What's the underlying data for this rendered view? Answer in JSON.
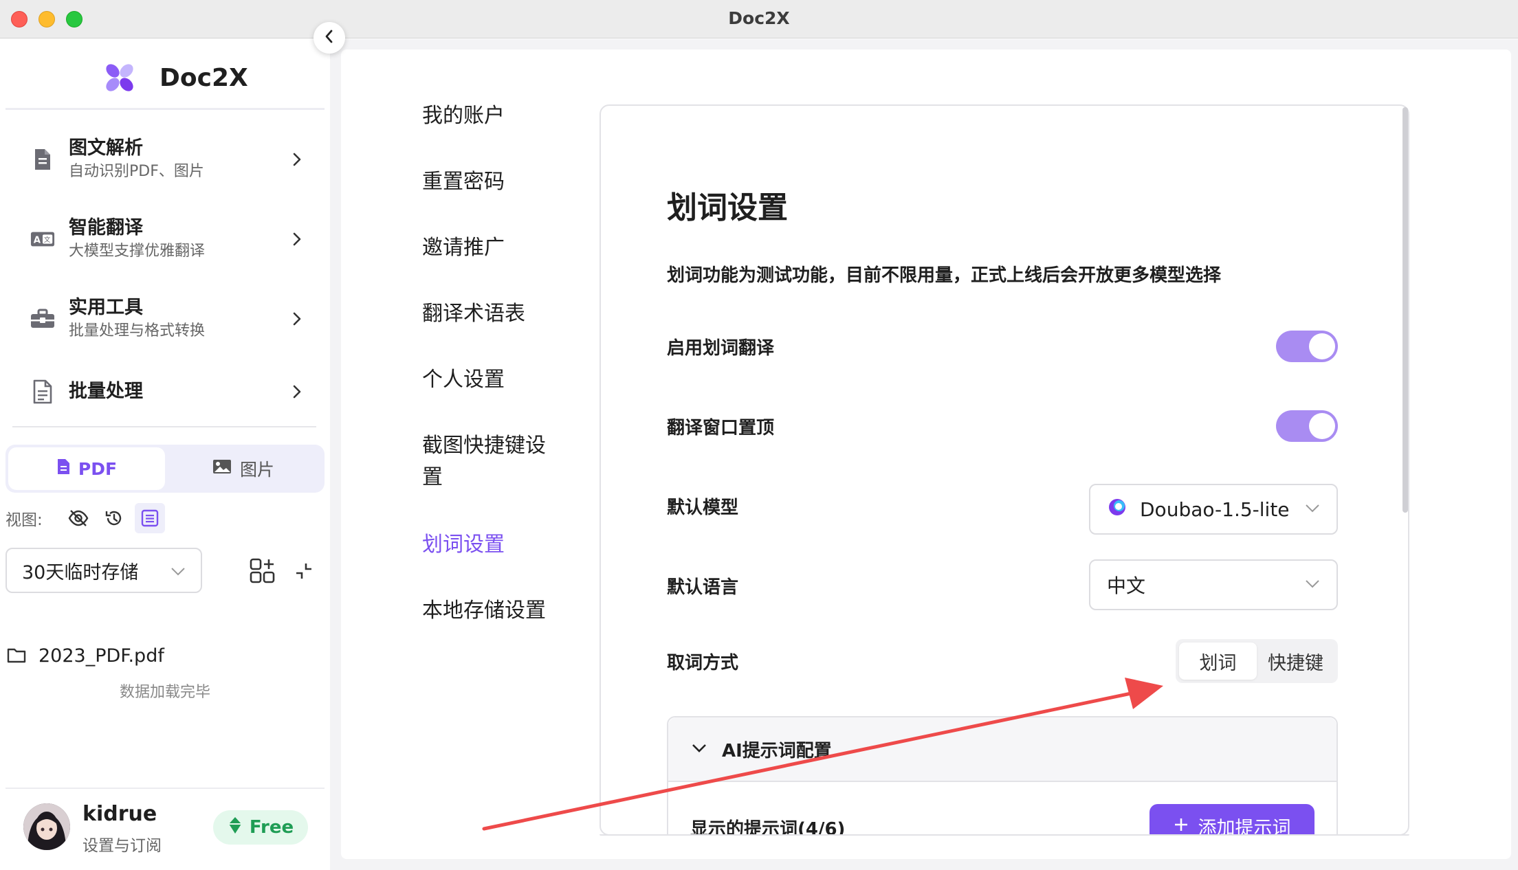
{
  "window": {
    "title": "Doc2X"
  },
  "brand": {
    "name": "Doc2X"
  },
  "sidebar": {
    "items": [
      {
        "title": "图文解析",
        "sub": "自动识别PDF、图片",
        "icon": "document-icon"
      },
      {
        "title": "智能翻译",
        "sub": "大模型支撑优雅翻译",
        "icon": "translate-icon"
      },
      {
        "title": "实用工具",
        "sub": "批量处理与格式转换",
        "icon": "toolbox-icon"
      },
      {
        "title": "批量处理",
        "sub": "",
        "icon": "file-list-icon"
      }
    ],
    "tabs": {
      "pdf": "PDF",
      "image": "图片",
      "active": "pdf"
    },
    "view_label": "视图:",
    "storage_select": "30天临时存储",
    "file_name": "2023_PDF.pdf",
    "loaded_text": "数据加载完毕"
  },
  "user": {
    "name": "kidrue",
    "sub": "设置与订阅",
    "plan": "Free"
  },
  "settings_nav": [
    {
      "label": "我的账户"
    },
    {
      "label": "重置密码"
    },
    {
      "label": "邀请推广"
    },
    {
      "label": "翻译术语表"
    },
    {
      "label": "个人设置"
    },
    {
      "label": "截图快捷键设置"
    },
    {
      "label": "划词设置",
      "active": true
    },
    {
      "label": "本地存储设置"
    }
  ],
  "settings": {
    "title": "划词设置",
    "description": "划词功能为测试功能，目前不限用量，正式上线后会开放更多模型选择",
    "enable_label": "启用划词翻译",
    "enable_on": true,
    "pin_label": "翻译窗口置顶",
    "pin_on": true,
    "model_label": "默认模型",
    "model_value": "Doubao-1.5-lite",
    "language_label": "默认语言",
    "language_value": "中文",
    "mode_label": "取词方式",
    "mode_options": [
      "划词",
      "快捷键"
    ],
    "mode_selected": "划词",
    "ai_section_title": "AI提示词配置",
    "prompt_count_label": "显示的提示词(4/6)",
    "add_prompt_label": "添加提示词"
  },
  "colors": {
    "accent": "#7b50f0",
    "toggle_on": "#a98cf2",
    "free_badge": "#1f9d55",
    "annotation_arrow": "#ee4a4a"
  }
}
